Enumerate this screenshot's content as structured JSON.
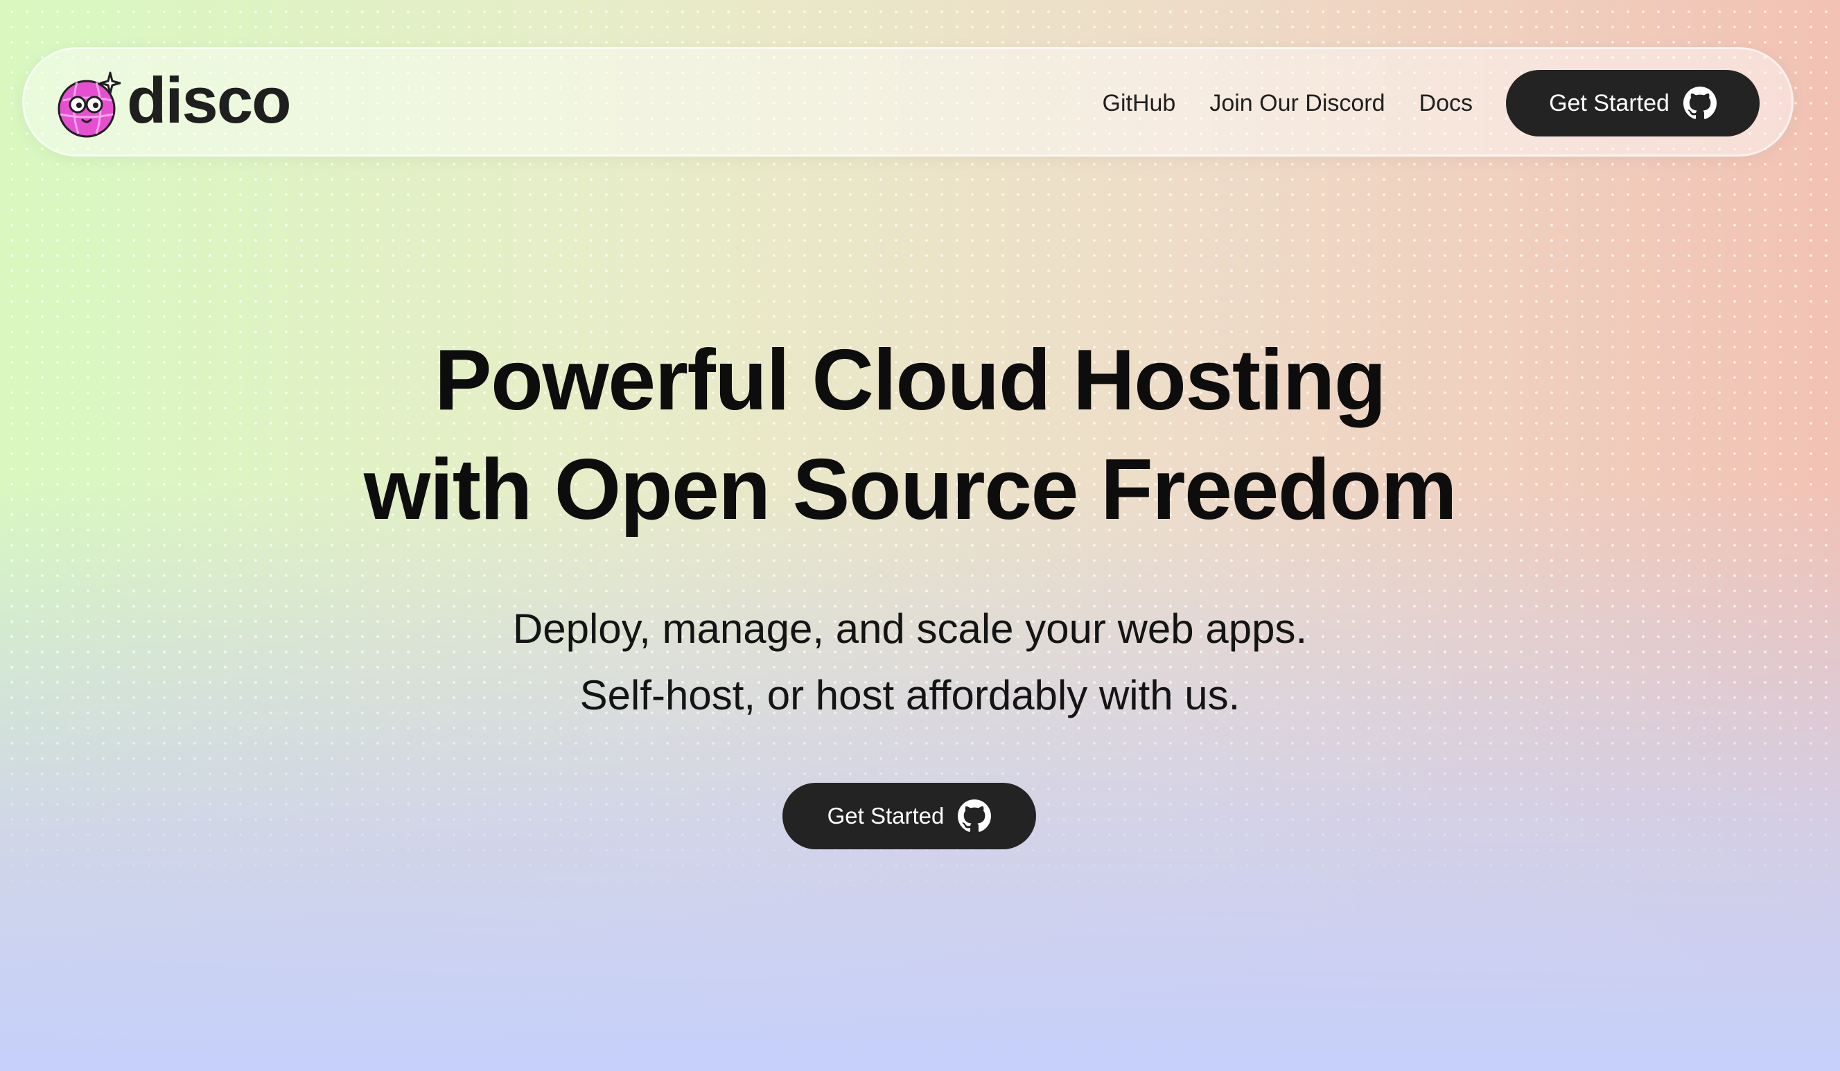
{
  "brand": {
    "name": "disco",
    "logo_icon": "disco-ball-mascot-icon",
    "accent_color": "#e64fd0"
  },
  "nav": {
    "links": [
      {
        "label": "GitHub"
      },
      {
        "label": "Join Our Discord"
      },
      {
        "label": "Docs"
      }
    ],
    "cta": {
      "label": "Get Started",
      "icon": "github-icon"
    }
  },
  "hero": {
    "title_lines": [
      "Powerful Cloud Hosting",
      "with Open Source Freedom"
    ],
    "subtitle_lines": [
      "Deploy, manage, and scale your web apps.",
      "Self-host, or host affordably with us."
    ],
    "cta": {
      "label": "Get Started",
      "icon": "github-icon"
    }
  },
  "colors": {
    "button_bg": "#232323",
    "button_text": "#ffffff",
    "text": "#0d0d0d"
  }
}
